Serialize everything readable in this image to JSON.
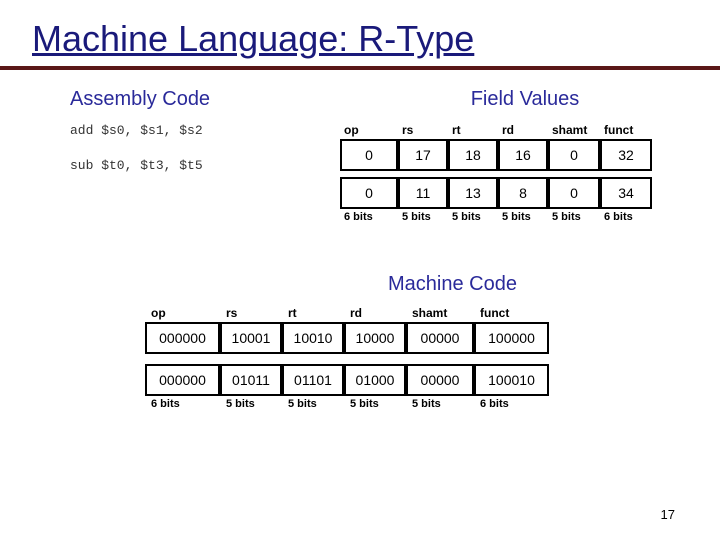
{
  "title": "Machine Language: R-Type",
  "assembly_label": "Assembly Code",
  "field_label": "Field Values",
  "machine_label": "Machine Code",
  "assembly": {
    "row1": "add $s0, $s1, $s2",
    "row2": "sub $t0, $t3, $t5"
  },
  "field_headers": {
    "op": "op",
    "rs": "rs",
    "rt": "rt",
    "rd": "rd",
    "shamt": "shamt",
    "funct": "funct"
  },
  "field_rows": [
    {
      "op": "0",
      "rs": "17",
      "rt": "18",
      "rd": "16",
      "shamt": "0",
      "funct": "32"
    },
    {
      "op": "0",
      "rs": "11",
      "rt": "13",
      "rd": "8",
      "shamt": "0",
      "funct": "34"
    }
  ],
  "bit_widths": {
    "op": "6 bits",
    "rs": "5 bits",
    "rt": "5 bits",
    "rd": "5 bits",
    "shamt": "5 bits",
    "funct": "6 bits"
  },
  "mc_headers": {
    "op": "op",
    "rs": "rs",
    "rt": "rt",
    "rd": "rd",
    "shamt": "shamt",
    "funct": "funct"
  },
  "mc_rows": [
    {
      "op": "000000",
      "rs": "10001",
      "rt": "10010",
      "rd": "10000",
      "shamt": "00000",
      "funct": "100000"
    },
    {
      "op": "000000",
      "rs": "01011",
      "rt": "01101",
      "rd": "01000",
      "shamt": "00000",
      "funct": "100010"
    }
  ],
  "page_num": "17"
}
